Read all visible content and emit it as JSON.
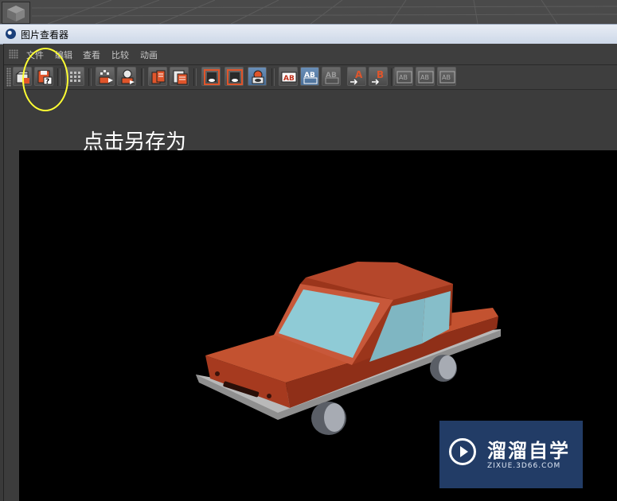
{
  "window": {
    "title": "图片查看器"
  },
  "menu": {
    "items": [
      "文件",
      "编辑",
      "查看",
      "比较",
      "动画"
    ]
  },
  "annotation": {
    "text": "点击另存为",
    "ring_color": "#ffff33"
  },
  "toolbar": {
    "buttons": [
      "open-icon",
      "save-as-icon",
      "channels-icon",
      "import-icon",
      "export-icon",
      "copy-icon",
      "layers-icon",
      "view-a-icon",
      "view-b-icon",
      "view-ab-icon",
      "ab-icon",
      "ab-split-icon",
      "ab-ghost-icon",
      "set-a-icon",
      "set-b-icon",
      "compare-1-icon",
      "compare-2-icon",
      "compare-3-icon"
    ]
  },
  "render": {
    "background": "#000000",
    "car_body_color": "#b5472b",
    "window_color": "#8fcbd6",
    "wheel_color": "#9a9ea8"
  },
  "watermark": {
    "title": "溜溜自学",
    "url": "ZIXUE.3D66.COM"
  }
}
